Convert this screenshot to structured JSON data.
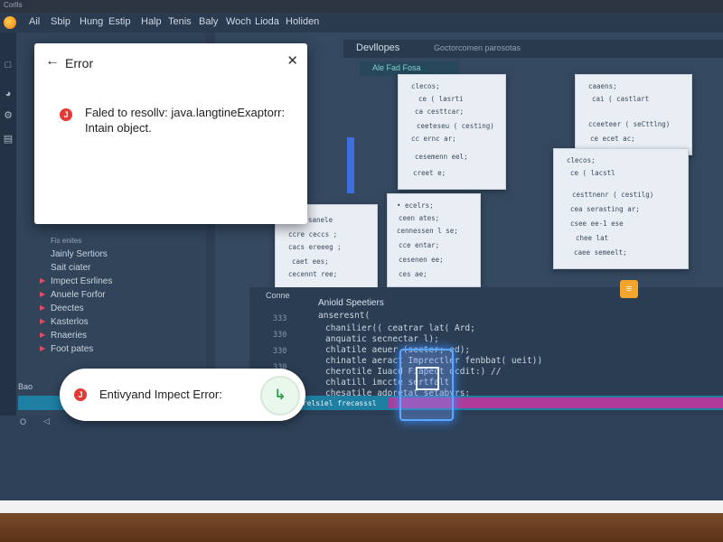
{
  "window_title": "Corlls",
  "menu": [
    "Ail",
    "Sbip",
    "Hung",
    "Estip",
    "Halp",
    "Tenis",
    "Baly",
    "Woch",
    "Lioda",
    "Holiden"
  ],
  "explorer": {
    "items": [
      {
        "label": "Fis enites"
      },
      {
        "label": "Jainly Sertiors"
      },
      {
        "label": "Sait ciater"
      },
      {
        "label": "Impect Esrlines"
      },
      {
        "label": "Anuele Forfor"
      },
      {
        "label": "Deectes"
      },
      {
        "label": "Kasterlos"
      },
      {
        "label": "Rnaeries"
      },
      {
        "label": "Foot pates"
      }
    ]
  },
  "editor": {
    "header_label": "Devllopes",
    "header_sublabel": "Goctorcomen parosotas",
    "subtab_label": "Ale Fad Fosa"
  },
  "bottom_panel": {
    "tab_label": "Conne",
    "title": "Aniold Speetiers",
    "line_numbers": [
      "333",
      "330",
      "330",
      "330"
    ],
    "code_lines": [
      "anseresnt(",
      "chanilier(( ceatrar lat( Ard;",
      "anquatic secnectar l);",
      "chlatile aeuer (secter; ed);",
      "chinatle aeract Imprectler fenbbat( ueit))",
      "cherotile Iuacd Fiapect ocdit:) //",
      "chlatill imccte sertfalt",
      "chesatile adpretat setabyrs;",
      "chanitle onstele rue); Ld3);"
    ],
    "status_strip": "Prelsiel frecasssl"
  },
  "bottom_left": {
    "tab_label": "Bao",
    "controls": "O"
  },
  "dialog": {
    "title": "Error",
    "message": "Faled to resollv: java.langtineExaptorr: Intain object.",
    "icon_glyph": "J"
  },
  "toast": {
    "message": "Entivyand Impect Error:",
    "icon_glyph": "J"
  },
  "colors": {
    "error_red": "#e53935",
    "accent_blue": "#3d6fe0",
    "status_teal": "#1e7fa3",
    "status_magenta": "#b03a98",
    "notification_orange": "#f4a52c"
  }
}
